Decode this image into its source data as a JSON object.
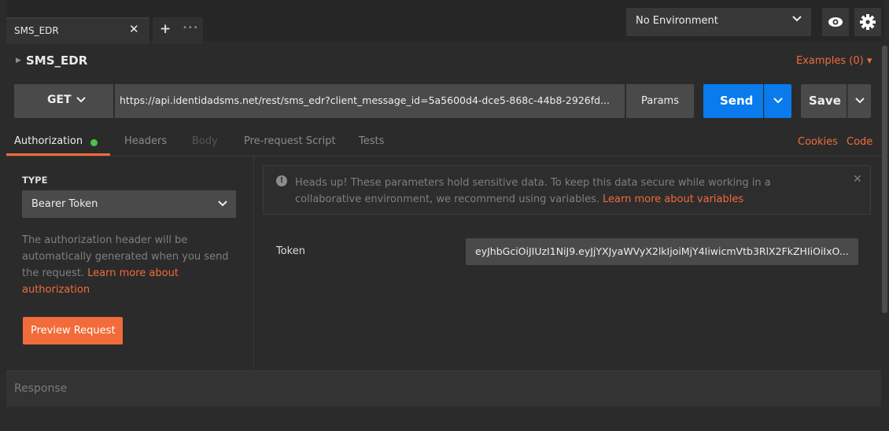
{
  "tabs": [
    {
      "label": "SMS_EDR",
      "close": "✕"
    }
  ],
  "new_tab": {
    "plus": "+",
    "more": "•••"
  },
  "environment": {
    "selected": "No Environment"
  },
  "request": {
    "name": "SMS_EDR",
    "examples_label": "Examples (0) ▾",
    "method": "GET",
    "url": "https://api.identidadsms.net/rest/sms_edr?client_message_id=5a5600d4-dce5-868c-44b8-2926fd...",
    "params_label": "Params",
    "send_label": "Send",
    "save_label": "Save"
  },
  "request_tabs": [
    {
      "label": "Authorization",
      "active": true
    },
    {
      "label": "Headers",
      "active": false
    },
    {
      "label": "Body",
      "active": false
    },
    {
      "label": "Pre-request Script",
      "active": false
    },
    {
      "label": "Tests",
      "active": false
    }
  ],
  "links": {
    "cookies": "Cookies",
    "code": "Code"
  },
  "auth": {
    "type_label": "TYPE",
    "type_value": "Bearer Token",
    "help_text": "The authorization header will be automatically generated when you send the request.",
    "help_link": "Learn more about authorization",
    "preview_button": "Preview Request"
  },
  "notice": {
    "text": "Heads up! These parameters hold sensitive data. To keep this data secure while working in a collaborative environment, we recommend using variables.",
    "link": "Learn more about variables",
    "icon": "!",
    "close": "✕"
  },
  "token": {
    "label": "Token",
    "value": "eyJhbGciOiJIUzI1NiJ9.eyJjYXJyaWVyX2lkIjoiMjY4IiwicmVtb3RlX2FkZHIiOiIxO..."
  },
  "response": {
    "label": "Response"
  },
  "colors": {
    "accent": "#f26b3a",
    "send": "#097bed",
    "active_dot": "#4bc24b"
  }
}
